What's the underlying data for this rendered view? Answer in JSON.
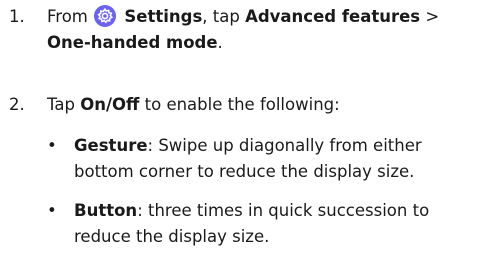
{
  "steps": [
    {
      "number": "1.",
      "prefix": "From",
      "settings_label": "Settings",
      "mid": ", tap",
      "advanced_label": "Advanced features",
      "separator": " >",
      "one_handed_label": "One-handed mode",
      "suffix": "."
    },
    {
      "number": "2.",
      "prefix": "Tap",
      "onoff_label": "On/Off",
      "suffix": " to enable the following:"
    }
  ],
  "bullets": [
    {
      "dot": "•",
      "label": "Gesture",
      "text_line1": ": Swipe up diagonally from either",
      "text_line2": "bottom corner to reduce the display size."
    },
    {
      "dot": "•",
      "label": "Button",
      "text_line1": ": three times in quick succession to",
      "text_line2": "reduce the display size."
    }
  ],
  "icon": {
    "name": "settings-gear-icon",
    "color_outer": "#6b63f0",
    "color_inner": "#ffffff"
  }
}
